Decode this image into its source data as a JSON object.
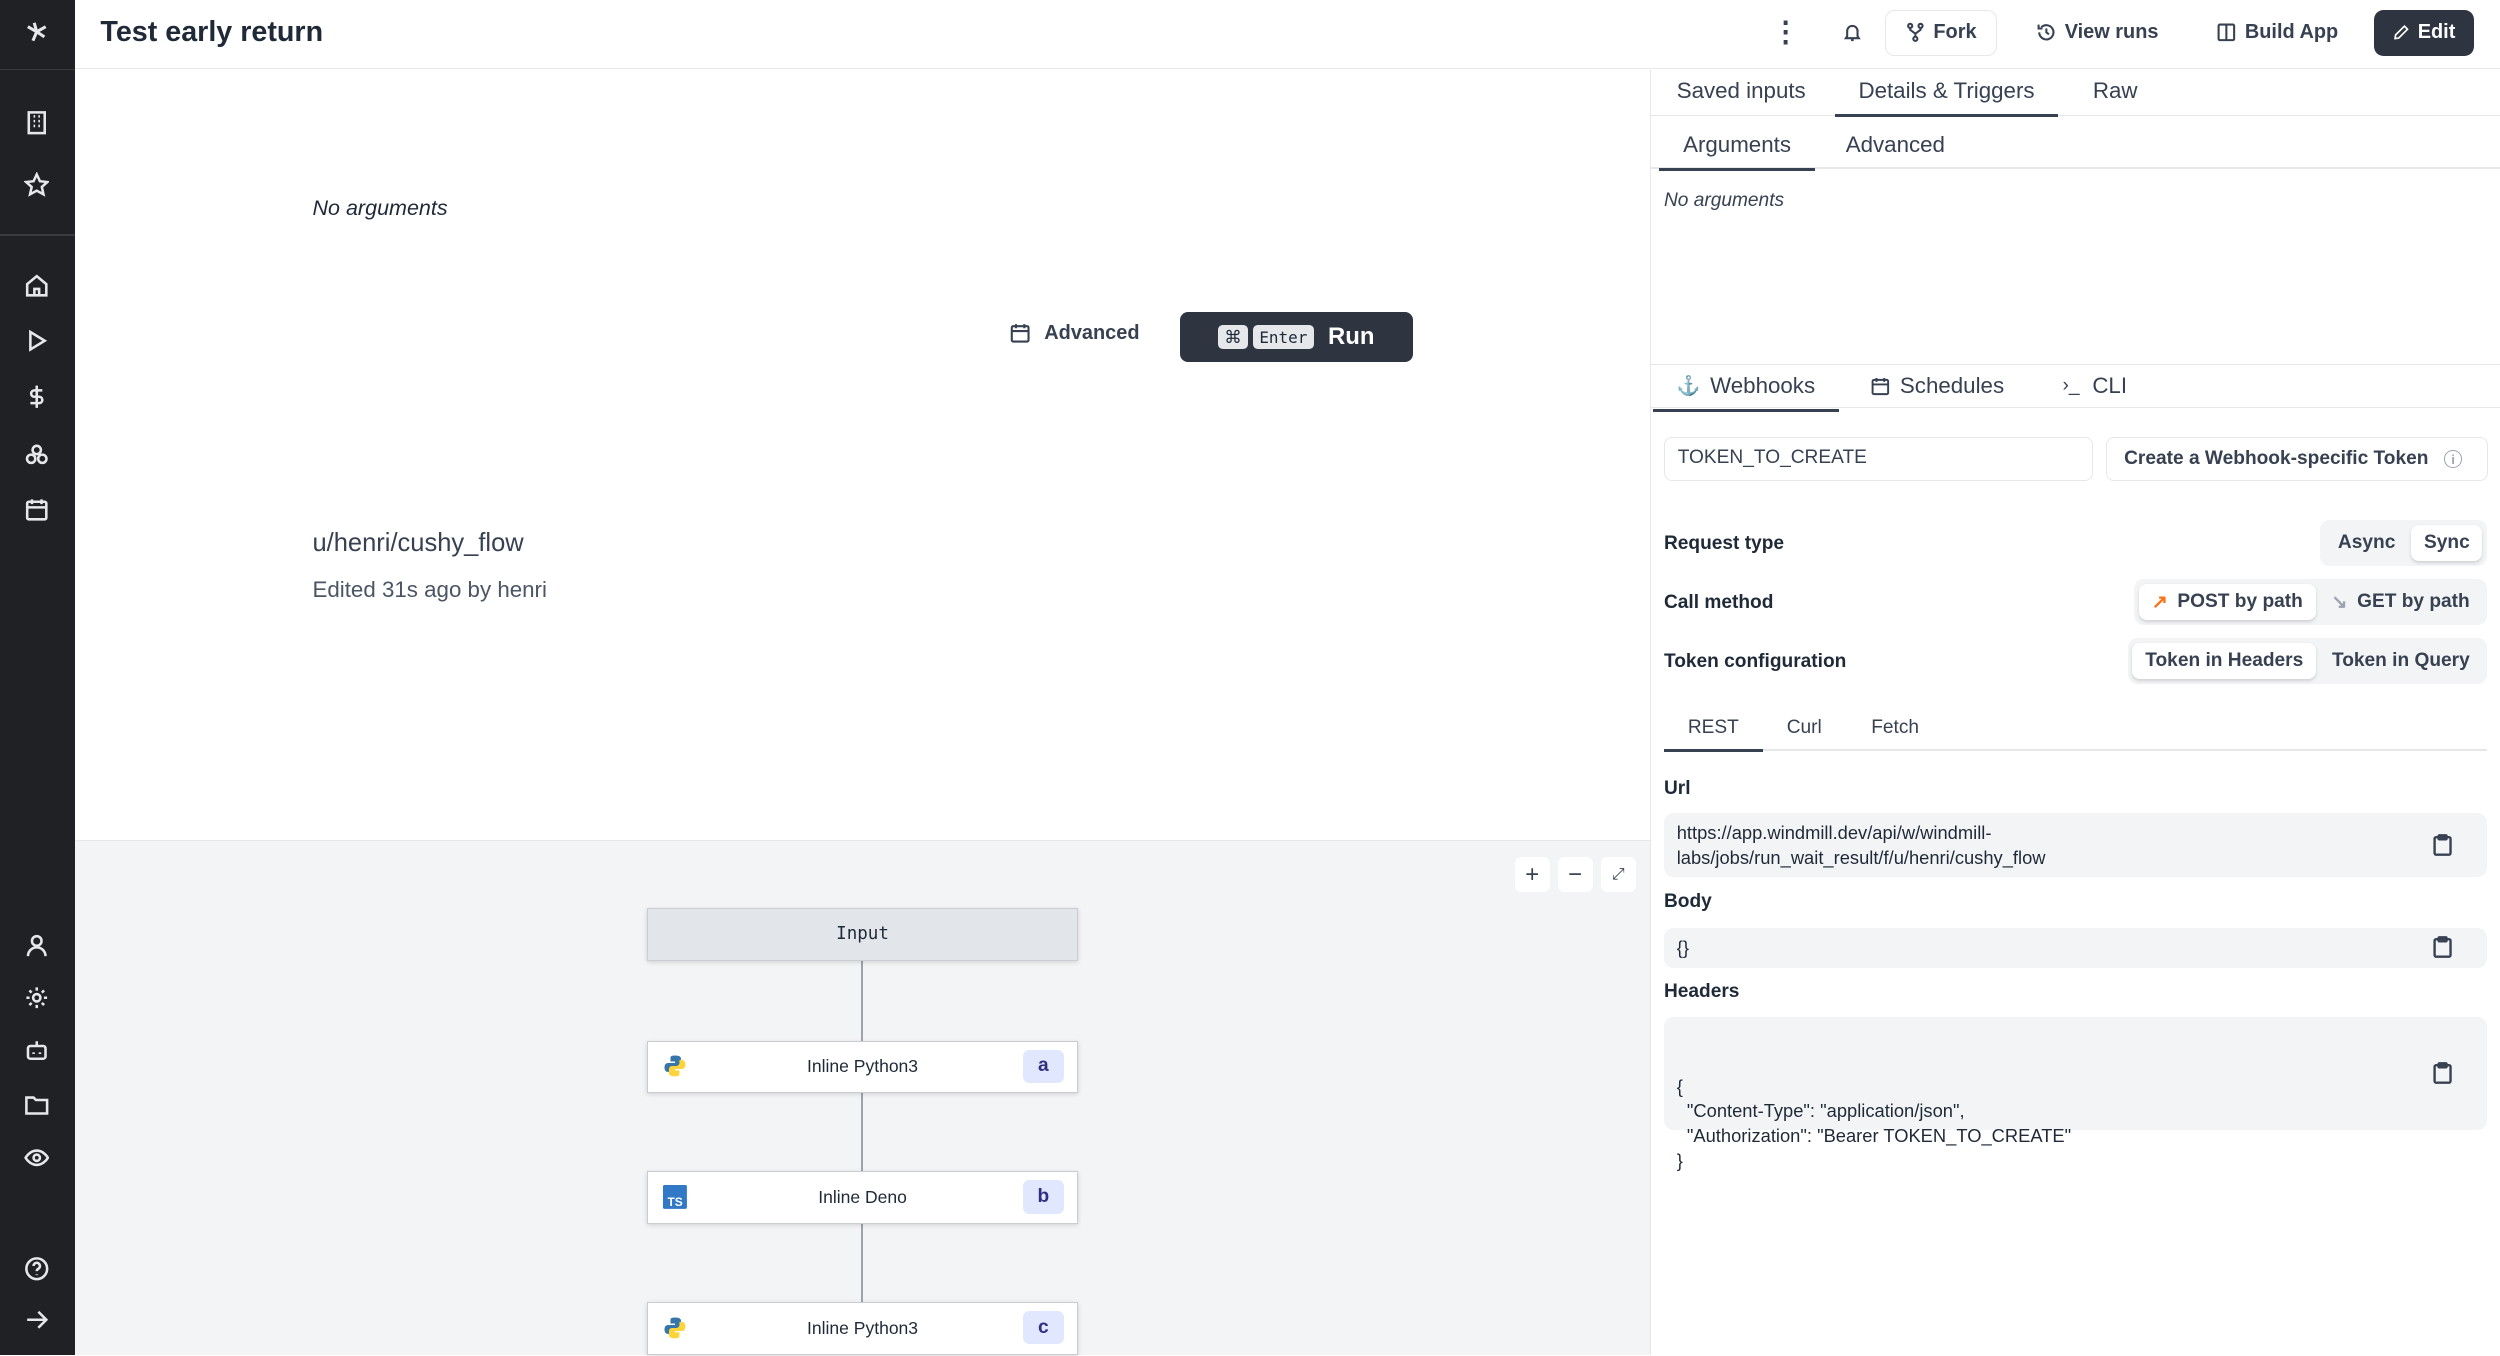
{
  "header": {
    "title": "Test early return",
    "fork": "Fork",
    "view_runs": "View runs",
    "build_app": "Build App",
    "edit": "Edit"
  },
  "sidebar": {
    "items": [
      "workspace",
      "favorites",
      "home",
      "runs",
      "variables",
      "resources",
      "schedules",
      "user",
      "settings",
      "workers",
      "folders",
      "audit",
      "help",
      "expand"
    ]
  },
  "main": {
    "no_arguments": "No arguments",
    "advanced": "Advanced",
    "run_key1": "⌘",
    "run_key2": "Enter",
    "run": "Run",
    "path": "u/henri/cushy_flow",
    "edited": "Edited 31s ago by henri"
  },
  "graph": {
    "nodes": [
      {
        "label": "Input"
      },
      {
        "label": "Inline Python3",
        "id": "a",
        "lang": "python"
      },
      {
        "label": "Inline Deno",
        "id": "b",
        "lang": "typescript"
      },
      {
        "label": "Inline Python3",
        "id": "c",
        "lang": "python"
      }
    ],
    "zoom_in": "+",
    "zoom_out": "−"
  },
  "panel": {
    "tabs": [
      "Saved inputs",
      "Details & Triggers",
      "Raw"
    ],
    "subtabs": [
      "Arguments",
      "Advanced"
    ],
    "no_arguments": "No arguments",
    "trigger_tabs": [
      "Webhooks",
      "Schedules",
      "CLI"
    ],
    "token_value": "TOKEN_TO_CREATE",
    "create_token": "Create a Webhook-specific Token",
    "request_type": {
      "label": "Request type",
      "options": [
        "Async",
        "Sync"
      ],
      "selected": "Sync"
    },
    "call_method": {
      "label": "Call method",
      "options": [
        "POST by path",
        "GET by path"
      ],
      "selected": "POST by path"
    },
    "token_config": {
      "label": "Token configuration",
      "options": [
        "Token in Headers",
        "Token in Query"
      ],
      "selected": "Token in Headers"
    },
    "code_tabs": [
      "REST",
      "Curl",
      "Fetch"
    ],
    "url_label": "Url",
    "url_line1": "https://app.windmill.dev/api/w/windmill-",
    "url_line2": "labs/jobs/run_wait_result/f/u/henri/cushy_flow",
    "body_label": "Body",
    "body": "{}",
    "headers_label": "Headers",
    "headers_lines": [
      "{",
      "  \"Content-Type\": \"application/json\",",
      "  \"Authorization\": \"Bearer TOKEN_TO_CREATE\"",
      "}"
    ],
    "accent": "#f97316"
  }
}
